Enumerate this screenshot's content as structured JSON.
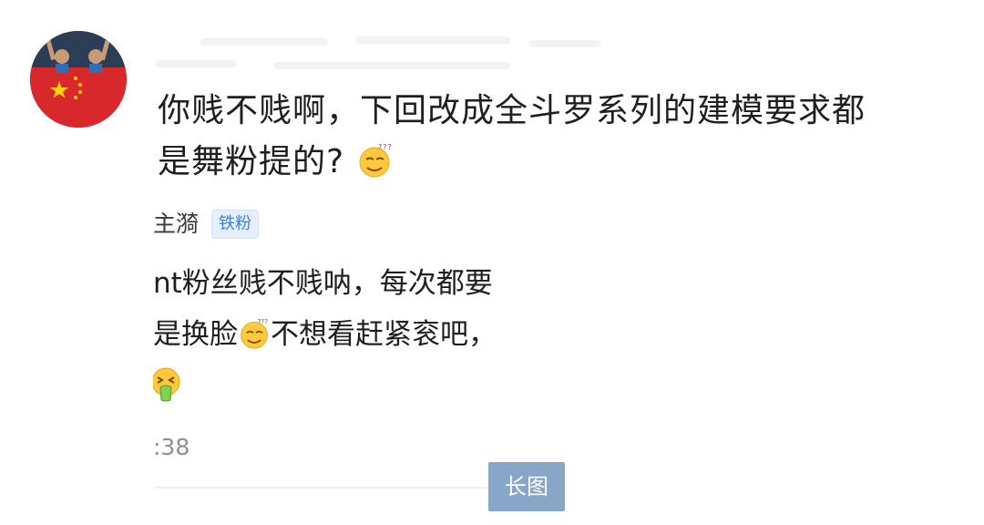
{
  "comment": {
    "lines": [
      "你贱不贱啊，下回改成全斗罗系列的建模要求都",
      "是舞粉提的?"
    ],
    "emoji": "smirk-sweat-emoji"
  },
  "reply": {
    "user_fragment": "主漪",
    "badge": "铁粉",
    "lines": [
      "nt粉丝贱不贱呐，每次都要",
      "是换脸",
      "不想看赶紧衮吧，"
    ],
    "emoji_inline": "smirk-sweat-emoji",
    "emoji_trailing": "vomit-emoji",
    "timestamp": ":38"
  },
  "long_image_button": "长图",
  "colors": {
    "badge_bg": "#e6f0fd",
    "badge_text": "#3d7fd9",
    "button_bg": "#88a6c8",
    "timestamp": "#8f8f8f"
  }
}
